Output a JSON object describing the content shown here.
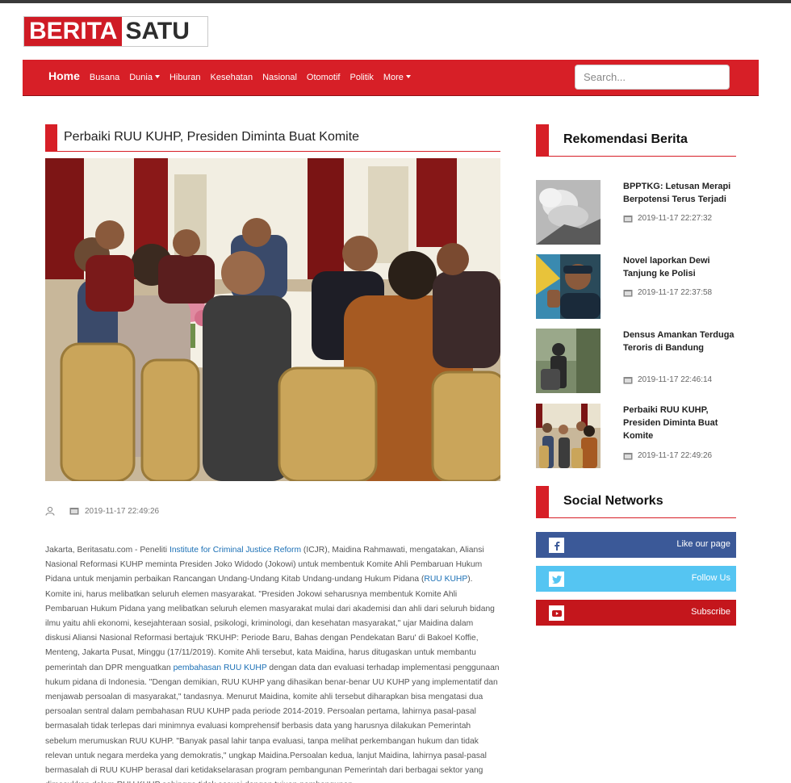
{
  "logo": {
    "left": "BERITA",
    "right": "SATU"
  },
  "nav": {
    "home": "Home",
    "items": [
      "Busana",
      "Dunia",
      "Hiburan",
      "Kesehatan",
      "Nasional",
      "Otomotif",
      "Politik",
      "More"
    ],
    "search_placeholder": "Search..."
  },
  "article": {
    "title": "Perbaiki RUU KUHP, Presiden Diminta Buat Komite",
    "date": "2019-11-17 22:49:26",
    "p1": "Jakarta, Beritasatu.com - Peneliti ",
    "link1": "Institute for Criminal Justice Reform",
    "p2": " (ICJR), Maidina Rahmawati, mengatakan, Aliansi Nasional Reformasi KUHP meminta Presiden Joko Widodo (Jokowi) untuk membentuk Komite Ahli Pembaruan Hukum Pidana untuk menjamin perbaikan Rancangan Undang-Undang Kitab Undang-undang Hukum Pidana (",
    "link2": "RUU KUHP",
    "p3": "). Komite ini, harus melibatkan seluruh elemen masyarakat. \"Presiden Jokowi seharusnya membentuk Komite Ahli Pembaruan Hukum Pidana yang melibatkan seluruh elemen masyarakat mulai dari akademisi dan ahli dari seluruh bidang ilmu yaitu ahli ekonomi, kesejahteraan sosial, psikologi, kriminologi, dan kesehatan masyarakat,\" ujar Maidina dalam diskusi Aliansi Nasional Reformasi bertajuk 'RKUHP: Periode Baru, Bahas dengan Pendekatan Baru' di Bakoel Koffie, Menteng, Jakarta Pusat, Minggu (17/11/2019). Komite Ahli tersebut, kata Maidina, harus ditugaskan untuk membantu pemerintah dan DPR menguatkan ",
    "link3": "pembahasan RUU KUHP",
    "p4": " dengan data dan evaluasi terhadap implementasi penggunaan hukum pidana di Indonesia. \"Dengan demikian, RUU KUHP yang dihasikan benar-benar UU KUHP yang implementatif dan menjawab persoalan di masyarakat,\" tandasnya. Menurut Maidina, komite ahli tersebut diharapkan bisa mengatasi dua persoalan sentral dalam pembahasan RUU KUHP pada periode 2014-2019. Persoalan pertama, lahirnya pasal-pasal bermasalah tidak terlepas dari minimnya evaluasi komprehensif berbasis data yang harusnya dilakukan Pemerintah sebelum merumuskan RUU KUHP. \"Banyak pasal lahir tanpa evaluasi, tanpa melihat perkembangan hukum dan tidak relevan untuk negara merdeka yang demokratis,\" ungkap Maidina.Persoalan kedua, lanjut Maidina, lahirnya pasal-pasal bermasalah di RUU KUHP berasal dari ketidakselarasan program pembangunan Pemerintah dari berbagai sektor yang dimasukkan dalam RUU KUHP sehingga tidak sesuai dengan tujuan pembangunan"
  },
  "sidebar": {
    "rec_title": "Rekomendasi Berita",
    "items": [
      {
        "title": "BPPTKG: Letusan Merapi Berpotensi Terus Terjadi",
        "date": "2019-11-17 22:27:32"
      },
      {
        "title": "Novel laporkan Dewi Tanjung ke Polisi",
        "date": "2019-11-17 22:37:58"
      },
      {
        "title": "Densus Amankan Terduga Teroris di Bandung",
        "date": "2019-11-17 22:46:14"
      },
      {
        "title": "Perbaiki RUU KUHP, Presiden Diminta Buat Komite",
        "date": "2019-11-17 22:49:26"
      }
    ],
    "social_title": "Social Networks",
    "social": [
      {
        "label": "Like our page",
        "color": "#3b5998",
        "icon": "facebook-icon"
      },
      {
        "label": "Follow Us",
        "color": "#55c5f2",
        "icon": "twitter-icon"
      },
      {
        "label": "Subscribe",
        "color": "#c4161c",
        "icon": "youtube-icon"
      }
    ]
  }
}
